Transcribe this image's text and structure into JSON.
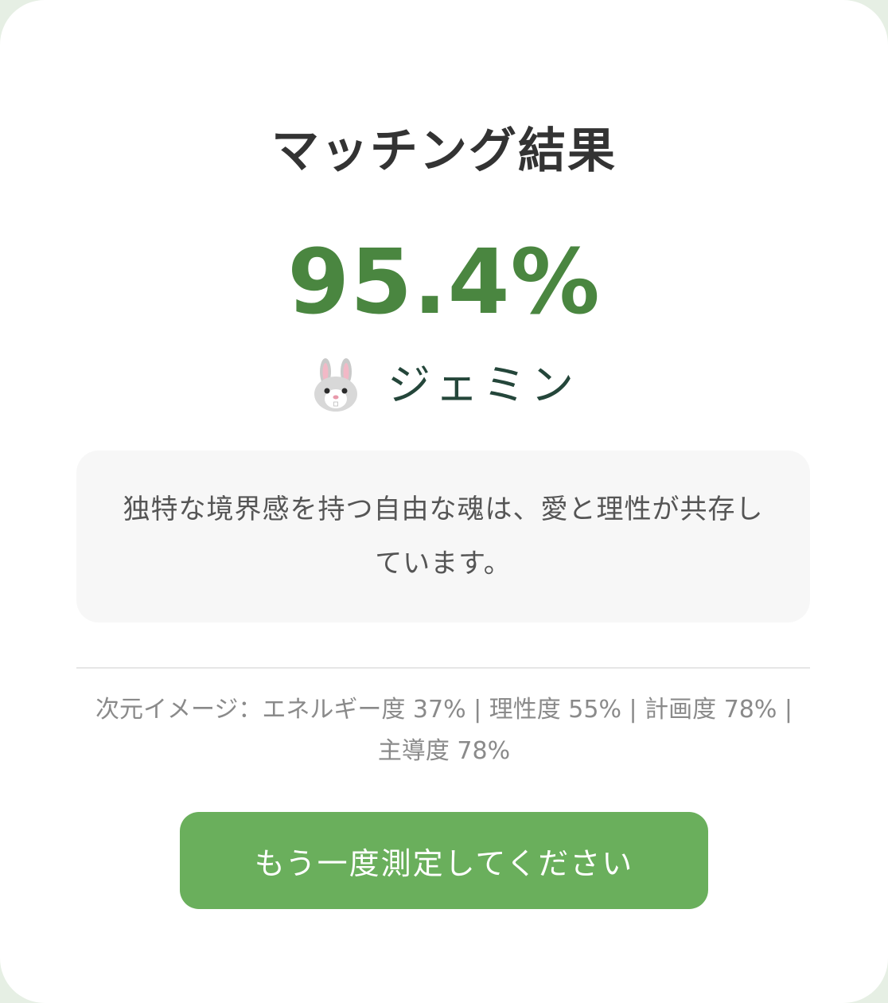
{
  "result": {
    "title": "マッチング結果",
    "score": "95.4%",
    "icon": "rabbit-face-icon",
    "name": "ジェミン",
    "description": "独特な境界感を持つ自由な魂は、愛と理性が共存しています。",
    "dimensions": "次元イメージ：エネルギー度 37% | 理性度 55% | 計画度 78% | 主導度 78%"
  },
  "actions": {
    "retry_label": "もう一度測定してください"
  },
  "colors": {
    "accent": "#4a8640",
    "button": "#6aaf5c",
    "background": "#e6efe4"
  }
}
